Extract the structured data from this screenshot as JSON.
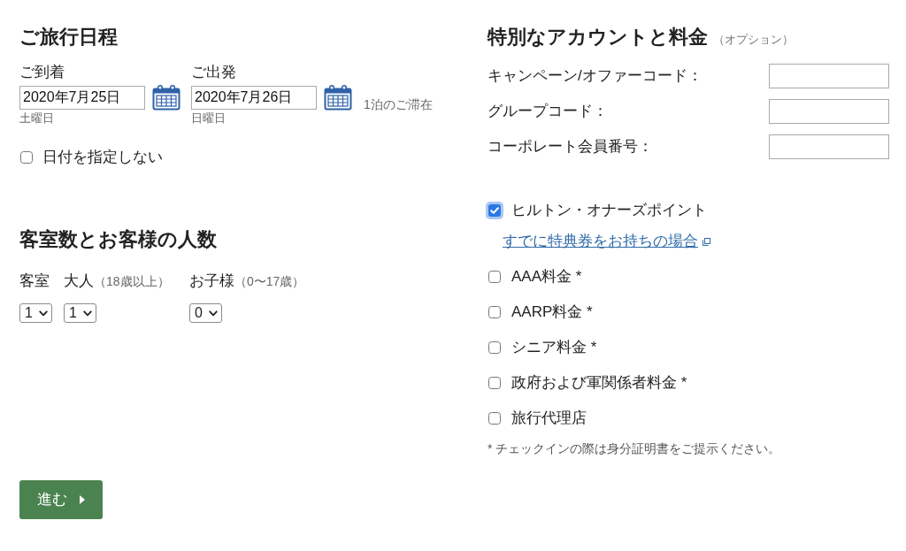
{
  "itinerary": {
    "heading": "ご旅行日程",
    "dates": [
      {
        "label": "ご到着",
        "value": "2020年7月25日",
        "weekday": "土曜日"
      },
      {
        "label": "ご出発",
        "value": "2020年7月26日",
        "weekday": "日曜日"
      }
    ],
    "stay_length": "1泊のご滞在",
    "no_dates": {
      "label": "日付を指定しない",
      "checked": false
    }
  },
  "rooms_guests": {
    "heading": "客室数とお客様の人数",
    "fields": [
      {
        "label": "客室",
        "value": "1"
      },
      {
        "label": "大人",
        "note": "（18歳以上）",
        "value": "1"
      },
      {
        "label": "お子様",
        "note": "（0〜17歳）",
        "value": "0"
      }
    ]
  },
  "continue_button": "進む",
  "special_rates": {
    "heading": "特別なアカウントと料金",
    "note": "（オプション）",
    "codes": [
      {
        "label": "キャンペーン/オファーコード："
      },
      {
        "label": "グループコード："
      },
      {
        "label": "コーポレート会員番号："
      }
    ],
    "options": [
      {
        "label": "ヒルトン・オナーズポイント",
        "checked": true,
        "focused": true,
        "link": "すでに特典券をお持ちの場合"
      },
      {
        "label": "AAA料金 *",
        "checked": false,
        "focused": false
      },
      {
        "label": "AARP料金 *",
        "checked": false,
        "focused": false
      },
      {
        "label": "シニア料金 *",
        "checked": false,
        "focused": false
      },
      {
        "label": "政府および軍関係者料金 *",
        "checked": false,
        "focused": false
      },
      {
        "label": "旅行代理店",
        "checked": false,
        "focused": false
      }
    ],
    "footnote": "* チェックインの際は身分証明書をご提示ください。"
  }
}
